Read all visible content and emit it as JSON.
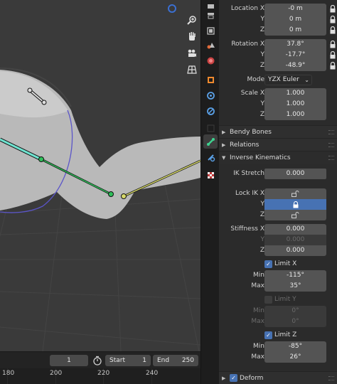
{
  "transform": {
    "location": {
      "label": "Location X",
      "x": "-0 m",
      "y_label": "Y",
      "y": "0 m",
      "z_label": "Z",
      "z": "0 m"
    },
    "rotation": {
      "label": "Rotation X",
      "x": "37.8°",
      "y_label": "Y",
      "y": "-17.7°",
      "z_label": "Z",
      "z": "-48.9°"
    },
    "mode": {
      "label": "Mode",
      "value": "YZX Euler"
    },
    "scale": {
      "label": "Scale X",
      "x": "1.000",
      "y_label": "Y",
      "y": "1.000",
      "z_label": "Z",
      "z": "1.000"
    }
  },
  "panels": {
    "bendy_bones": "Bendy Bones",
    "relations": "Relations",
    "inverse_kinematics": "Inverse Kinematics",
    "deform": "Deform"
  },
  "ik": {
    "stretch_label": "IK Stretch",
    "stretch_value": "0.000",
    "lock_label": "Lock IK X",
    "lock_y_label": "Y",
    "lock_z_label": "Z",
    "lock_y_on": true,
    "stiffness_label": "Stiffness X",
    "stiffness_x": "0.000",
    "stiffness_y_label": "Y",
    "stiffness_y": "0.000",
    "stiffness_z_label": "Z",
    "stiffness_z": "0.000",
    "limit_x": {
      "label": "Limit X",
      "checked": true,
      "min_label": "Min",
      "min": "-115°",
      "max_label": "Max",
      "max": "35°"
    },
    "limit_y": {
      "label": "Limit Y",
      "checked": false,
      "min_label": "Min",
      "min": "0°",
      "max_label": "Max",
      "max": "0°"
    },
    "limit_z": {
      "label": "Limit Z",
      "checked": true,
      "min_label": "Min",
      "min": "-85°",
      "max_label": "Max",
      "max": "26°"
    }
  },
  "timeline": {
    "current_frame": "1",
    "start_label": "Start",
    "start": "1",
    "end_label": "End",
    "end": "250",
    "ticks": [
      "180",
      "200",
      "220",
      "240"
    ]
  },
  "colors": {
    "accent": "#4772b3",
    "active_bone": "#6fe3d0",
    "selected_bone": "#2fbf5a",
    "yellow_bone": "#d6d86a",
    "circle": "#5b55c9"
  },
  "icons": {
    "zoom": "magnifier-icon",
    "pan": "hand-icon",
    "camera": "camera-icon",
    "ortho": "grid-icon",
    "stopwatch": "stopwatch-icon"
  }
}
